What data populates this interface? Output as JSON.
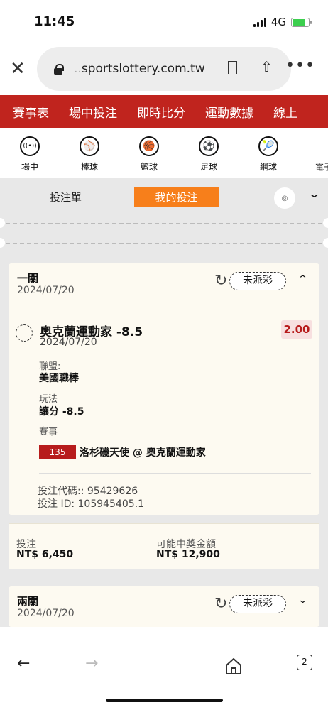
{
  "status": {
    "time": "11:45",
    "network": "4G"
  },
  "browser": {
    "url_prefix": "..",
    "url_main": "sportslottery.com.tw"
  },
  "nav": [
    "賽事表",
    "場中投注",
    "即時比分",
    "運動數據",
    "線上"
  ],
  "sports": [
    {
      "label": "場中",
      "icon": "live-icon",
      "glyph": "((•))"
    },
    {
      "label": "棒球",
      "icon": "baseball-icon",
      "glyph": "⚾"
    },
    {
      "label": "籃球",
      "icon": "basketball-icon",
      "glyph": "🏀"
    },
    {
      "label": "足球",
      "icon": "soccer-icon",
      "glyph": "⚽"
    },
    {
      "label": "網球",
      "icon": "tennis-icon",
      "glyph": "🎾"
    },
    {
      "label": "電子競",
      "icon": "esports-icon",
      "glyph": ""
    }
  ],
  "tabs": {
    "betslip": "投注單",
    "mybets": "我的投注"
  },
  "bet1": {
    "title": "一關",
    "date": "2024/07/20",
    "status": "未派彩",
    "selection": "奧克蘭運動家 -8.5",
    "sel_date": "2024/07/20",
    "odds": "2.00",
    "league_label": "聯盟:",
    "league": "美國職棒",
    "type_label": "玩法",
    "type": "讓分 -8.5",
    "event_label": "賽事",
    "match_no": "135",
    "match": "洛杉磯天使 @ 奧克蘭運動家",
    "code_line": "投注代碼:: 95429626",
    "id_line": "投注 ID: 105945405.1",
    "stake_label": "投注",
    "stake": "NT$ 6,450",
    "payout_label": "可能中獎金額",
    "payout": "NT$ 12,900"
  },
  "bet2": {
    "title": "兩關",
    "date": "2024/07/20",
    "status": "未派彩"
  },
  "bottom": {
    "tab_count": "2"
  }
}
